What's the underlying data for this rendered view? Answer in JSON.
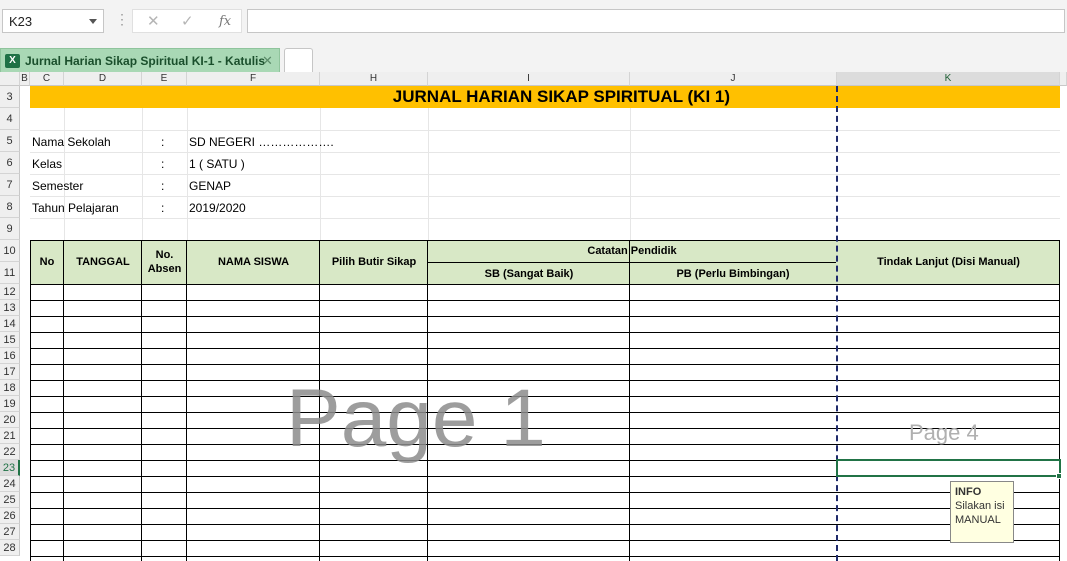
{
  "formula_bar": {
    "name_box": "K23",
    "cancel_icon": "x-icon",
    "enter_icon": "check-icon",
    "function_label": "fx",
    "formula_value": ""
  },
  "tabs": {
    "active_label": "Jurnal Harian Sikap Spiritual KI-1 - Katulis",
    "close_glyph": "✕"
  },
  "columns": [
    "B",
    "C",
    "D",
    "E",
    "F",
    "H",
    "I",
    "J",
    "K"
  ],
  "rows": [
    "3",
    "4",
    "5",
    "6",
    "7",
    "8",
    "9",
    "10",
    "11",
    "12",
    "13",
    "14",
    "15",
    "16",
    "17",
    "18",
    "19",
    "20",
    "21",
    "22",
    "23",
    "24",
    "25",
    "26",
    "27",
    "28"
  ],
  "sheet": {
    "title": "JURNAL HARIAN SIKAP SPIRITUAL (KI 1)",
    "info": [
      {
        "label": "Nama Sekolah",
        "sep": ":",
        "value": "SD NEGERI ………………."
      },
      {
        "label": "Kelas",
        "sep": ":",
        "value": "1 ( SATU )"
      },
      {
        "label": "Semester",
        "sep": ":",
        "value": "GENAP"
      },
      {
        "label": "Tahun Pelajaran",
        "sep": ":",
        "value": "2019/2020"
      }
    ],
    "headers": {
      "no": "No",
      "tanggal": "TANGGAL",
      "absen_1": "No.",
      "absen_2": "Absen",
      "nama": "NAMA SISWA",
      "butir": "Pilih Butir Sikap",
      "catatan": "Catatan Pendidik",
      "sb": "SB (Sangat Baik)",
      "pb": "PB (Perlu Bimbingan)",
      "tindak": "Tindak Lanjut (Disi Manual)"
    },
    "watermark_main": "Page 1",
    "watermark_side": "Page 4"
  },
  "comment": {
    "title": "INFO",
    "line1": "Silakan isi",
    "line2": "MANUAL"
  },
  "colors": {
    "title_band": "#ffc000",
    "header_fill": "#d8e8c6",
    "selection": "#217346",
    "page_break": "#1f2a6b"
  }
}
